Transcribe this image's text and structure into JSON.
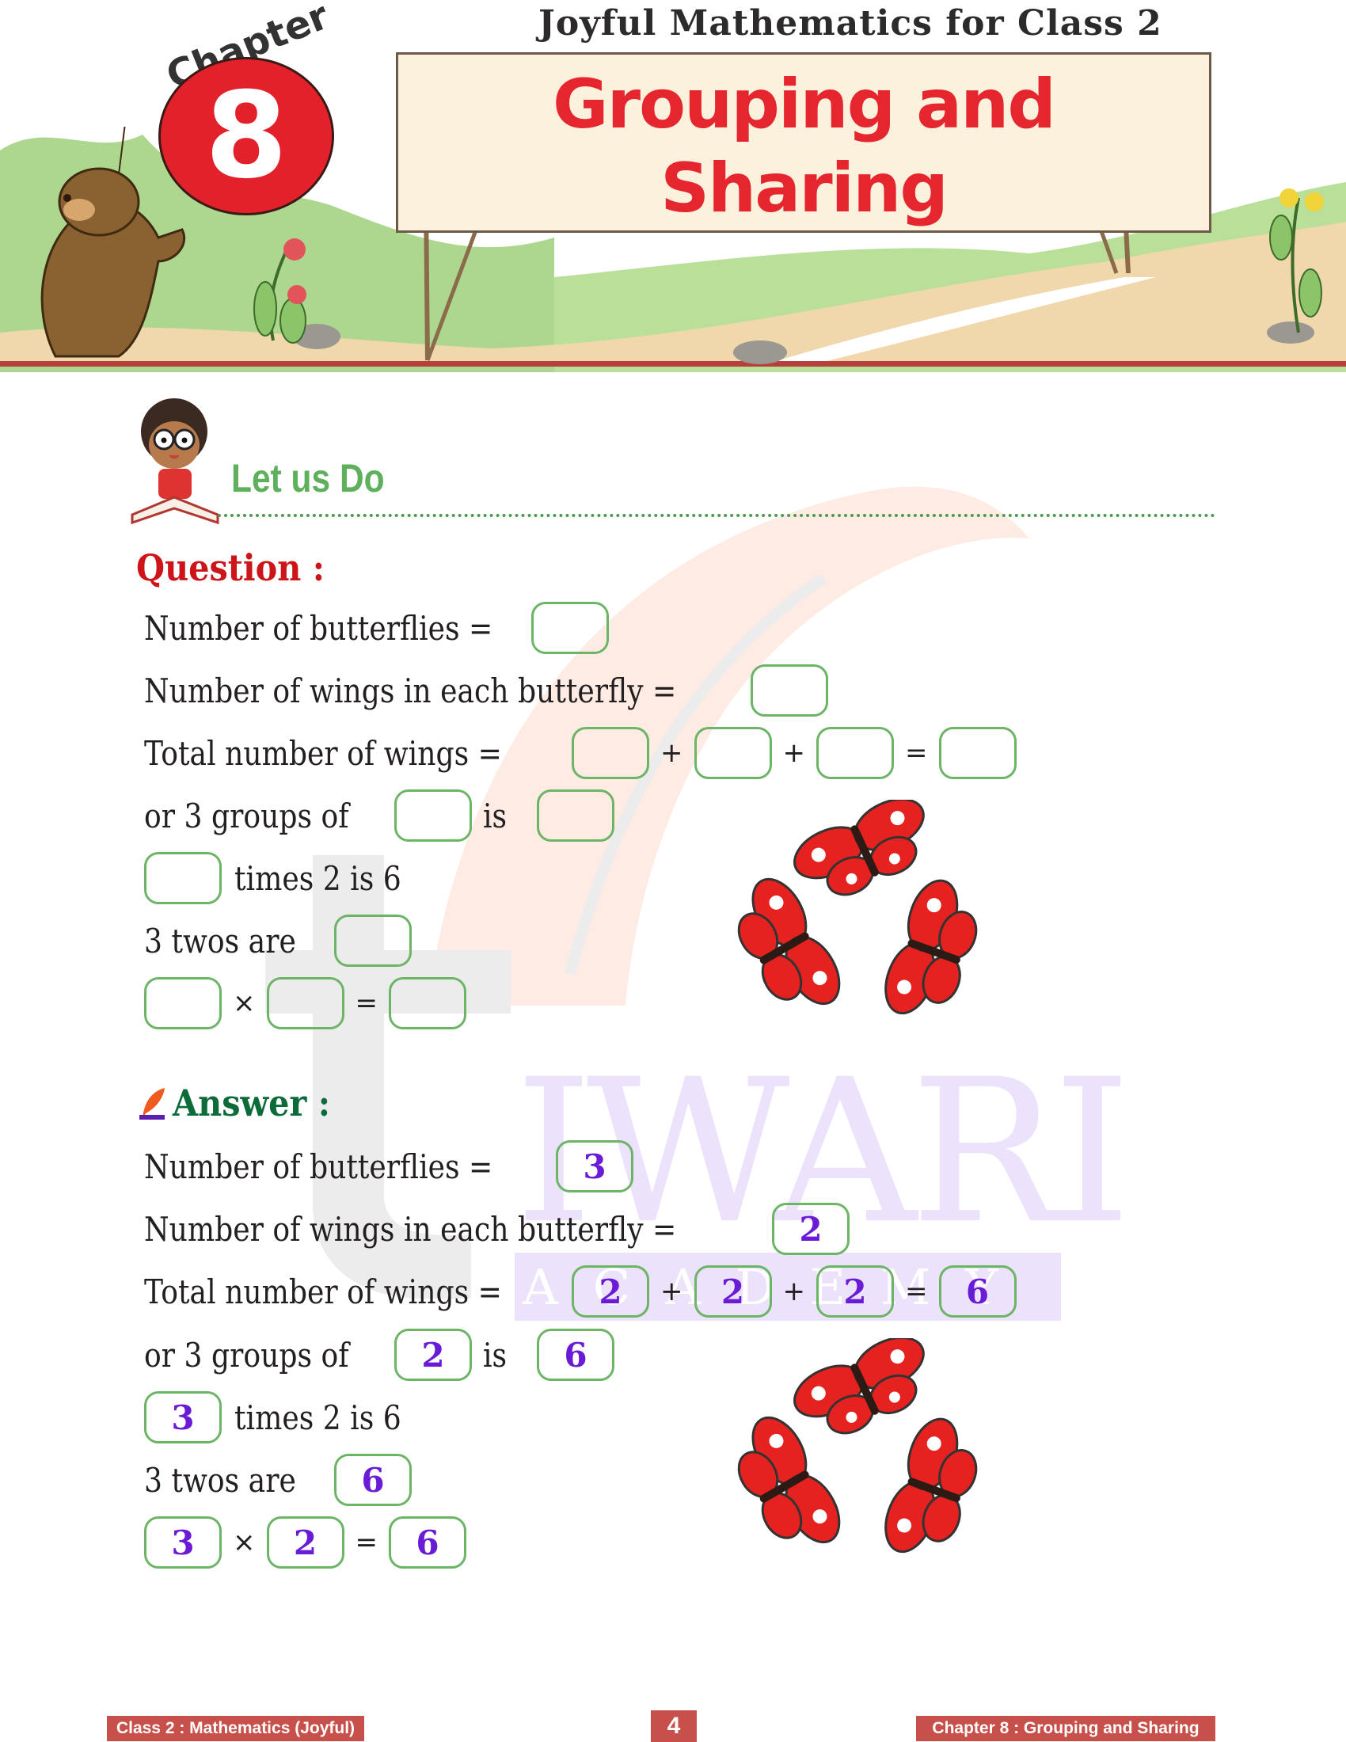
{
  "header": {
    "series_title": "Joyful Mathematics for Class 2",
    "chapter_word": "Chapter",
    "chapter_number": "8",
    "chapter_title_line1": "Grouping and",
    "chapter_title_line2": "Sharing"
  },
  "section": {
    "heading": "Let us Do"
  },
  "question": {
    "heading": "Question :",
    "rows": {
      "r1": {
        "label": "Number of butterflies ="
      },
      "r2": {
        "label": "Number of wings in each butterfly ="
      },
      "r3": {
        "label": "Total number of wings =",
        "op1": "+",
        "op2": "+",
        "op3": "="
      },
      "r4": {
        "pre": "or 3 groups of",
        "mid": "is"
      },
      "r5": {
        "post": "times 2 is 6"
      },
      "r6": {
        "label": "3 twos are"
      },
      "r7": {
        "op1": "×",
        "op2": "="
      }
    }
  },
  "answer": {
    "heading": "Answer :",
    "rows": {
      "r1": {
        "label": "Number of butterflies =",
        "v1": "3"
      },
      "r2": {
        "label": "Number of wings in each butterfly =",
        "v1": "2"
      },
      "r3": {
        "label": "Total number of wings =",
        "v1": "2",
        "op1": "+",
        "v2": "2",
        "op2": "+",
        "v3": "2",
        "op3": "=",
        "v4": "6"
      },
      "r4": {
        "pre": "or 3 groups of",
        "v1": "2",
        "mid": "is",
        "v2": "6"
      },
      "r5": {
        "v1": "3",
        "post": "times 2 is 6"
      },
      "r6": {
        "label": "3 twos are",
        "v1": "6"
      },
      "r7": {
        "v1": "3",
        "op1": "×",
        "v2": "2",
        "op2": "=",
        "v3": "6"
      }
    }
  },
  "illustration": {
    "butterfly_count": 3
  },
  "watermark": {
    "word": "IWARI",
    "subword": "ACADEMY"
  },
  "footer": {
    "left": "Class 2 : Mathematics (Joyful)",
    "page_number": "4",
    "right": "Chapter 8 : Grouping and Sharing"
  },
  "colors": {
    "title_red": "#e5262f",
    "box_green": "#6cb466",
    "answer_purple": "#6a1bd6",
    "answer_heading_green": "#0d6b3a",
    "question_heading_red": "#cc1419",
    "footer_red": "#c8504a"
  }
}
